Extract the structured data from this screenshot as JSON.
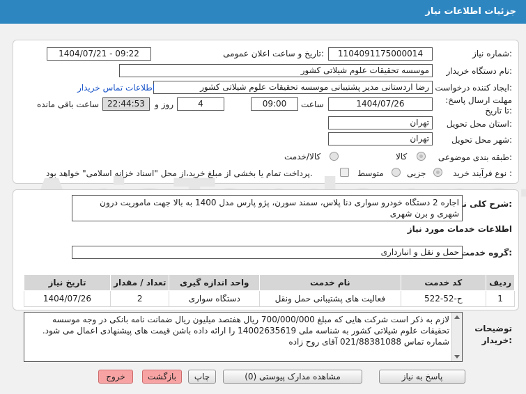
{
  "header": {
    "title": "جزئیات اطلاعات نیاز"
  },
  "watermark": {
    "text": "AriaTender.net"
  },
  "form": {
    "need_number_label": "شماره نیاز:",
    "need_number": "1104091175000014",
    "announce_label": "تاریخ و ساعت اعلان عمومی:",
    "announce_value": "1404/07/21 - 09:22",
    "buyer_org_label": "نام دستگاه خریدار:",
    "buyer_org": "موسسه تحقیقات علوم شیلاتی کشور",
    "creator_label": "ایجاد کننده درخواست:",
    "creator": "رضا  اردستانی مدیر پشتیبانی موسسه تحقیقات علوم شیلاتی کشور",
    "contact_link": "اطلاعات تماس خریدار",
    "deadline_label": "مهلت ارسال پاسخ: تا تاریخ:",
    "deadline_date": "1404/07/26",
    "time_label": "ساعت",
    "deadline_time": "09:00",
    "days_value": "4",
    "days_label": "روز و",
    "remaining_time": "22:44:53",
    "remaining_label": "ساعت باقی مانده",
    "province_label": "استان محل تحویل:",
    "province": "تهران",
    "city_label": "شهر محل تحویل:",
    "city": "تهران",
    "category_label": "طبقه بندی موضوعی:",
    "category_options": [
      "کالا",
      "کالا/خدمت"
    ],
    "process_label": "نوع فرآیند خرید :",
    "process_options": [
      "جزیی",
      "متوسط"
    ],
    "treasury_note": "پرداخت تمام یا بخشی از مبلغ خرید،از محل \"اسناد خزانه اسلامی\" خواهد بود."
  },
  "summary": {
    "label": "شرح کلی نیاز:",
    "text": "اجاره 2 دستگاه خودرو سواری دنا پلاس، سمند سورن، پژو پارس مدل 1400 به بالا جهت ماموریت درون شهری و برن شهری"
  },
  "services": {
    "section_title": "اطلاعات خدمات مورد نیاز",
    "group_label": "گروه خدمت:",
    "group_value": "حمل و نقل و انبارداری",
    "columns": [
      "ردیف",
      "کد خدمت",
      "نام خدمت",
      "واحد اندازه گیری",
      "تعداد / مقدار",
      "تاریخ نیاز"
    ],
    "rows": [
      [
        "1",
        "ح-52-522",
        "فعالیت های پشتیبانی حمل ونقل",
        "دستگاه سواری",
        "2",
        "1404/07/26"
      ]
    ]
  },
  "buyer_notes": {
    "label": "توضیحات خریدار:",
    "text": "لازم به ذکر است شرکت هایی که مبلغ 700/000/000 ریال هفتصد میلیون ریال ضمانت نامه بانکی در وجه موسسه تحقیقات علوم شیلاتی کشور به شناسه ملی 14002635619 را ارائه داده باشن قیمت های پیشنهادی اعمال می شود. شماره تماس 021/88381088 آقای روح زاده"
  },
  "buttons": {
    "reply": "پاسخ به نیاز",
    "attachments": "مشاهده مدارک پیوستی (0)",
    "print": "چاپ",
    "back": "بازگشت",
    "exit": "خروج"
  }
}
